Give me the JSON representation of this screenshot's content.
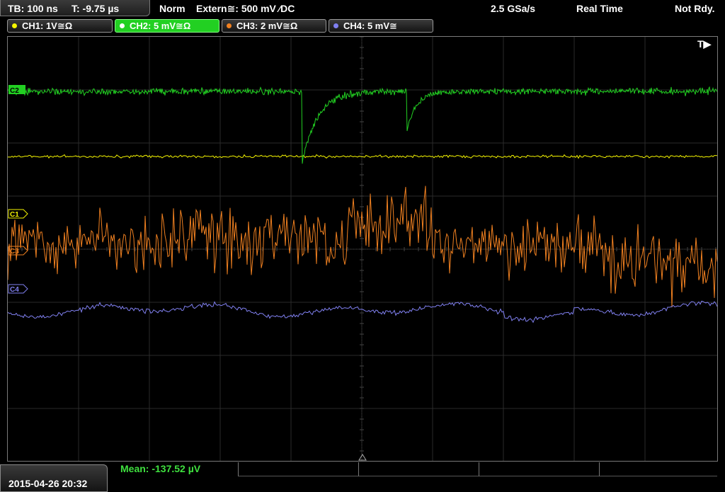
{
  "topbar": {
    "timebase": "TB: 100 ns",
    "trigger_time": "T: -9.75 µs",
    "mode": "Norm",
    "trigger_source": "Extern≅: 500 mV ⁄DC",
    "sample_rate": "2.5 GSa/s",
    "acquisition": "Real Time",
    "status": "Not Rdy."
  },
  "channels": [
    {
      "label": "CH1: 1V≅Ω",
      "color": "#f5f500",
      "active": false
    },
    {
      "label": "CH2: 5 mV≅Ω",
      "color": "#22d022",
      "active": true
    },
    {
      "label": "CH3: 2 mV≅Ω",
      "color": "#f08020",
      "active": false
    },
    {
      "label": "CH4: 5 mV≅",
      "color": "#8080f0",
      "active": false
    }
  ],
  "markers": {
    "ch2": "C2",
    "ch1": "C1",
    "ch3": "C3",
    "ch4": "C4",
    "trigger": "T▶"
  },
  "bottom": {
    "datetime": "2015-04-26 20:32",
    "measurement": "Mean: -137.52 µV"
  }
}
